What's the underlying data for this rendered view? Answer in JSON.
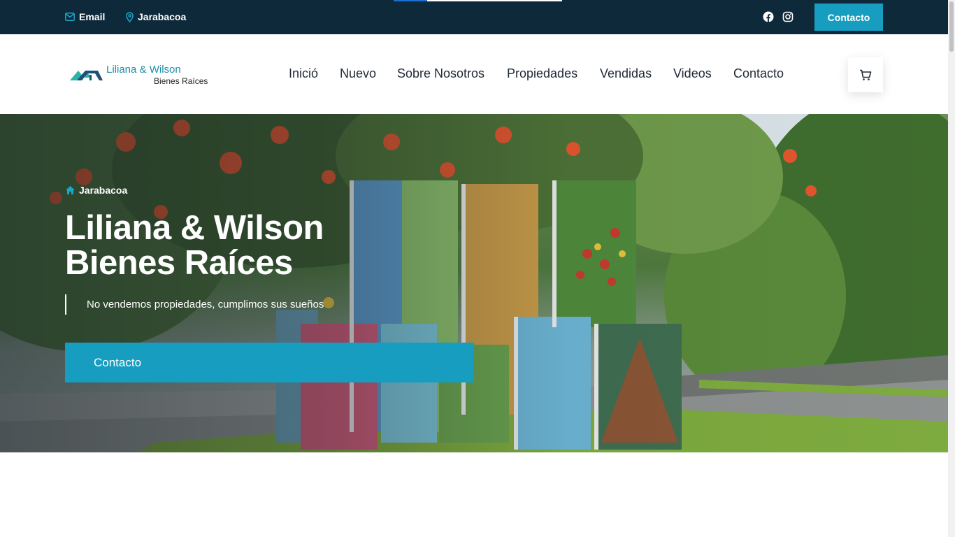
{
  "topbar": {
    "email_label": "Email",
    "location_label": "Jarabacoa",
    "social_icons": [
      "facebook-icon",
      "instagram-icon"
    ],
    "contact_button": "Contacto"
  },
  "header": {
    "logo_line1": "Liliana & Wilson",
    "logo_line2": "Bienes Raíces",
    "nav": [
      "Inició",
      "Nuevo",
      "Sobre Nosotros",
      "Propiedades",
      "Vendidas",
      "Videos",
      "Contacto"
    ],
    "cart_icon": "cart-icon"
  },
  "hero": {
    "breadcrumb": "Jarabacoa",
    "title_line1": "Liliana & Wilson",
    "title_line2": "Bienes Raíces",
    "tagline": "No vendemos propiedades, cumplimos sus sueños",
    "cta_button": "Contacto"
  },
  "colors": {
    "topbar_bg": "#0e2a3a",
    "accent": "#169dbf",
    "nav_text": "#1f2a36"
  }
}
